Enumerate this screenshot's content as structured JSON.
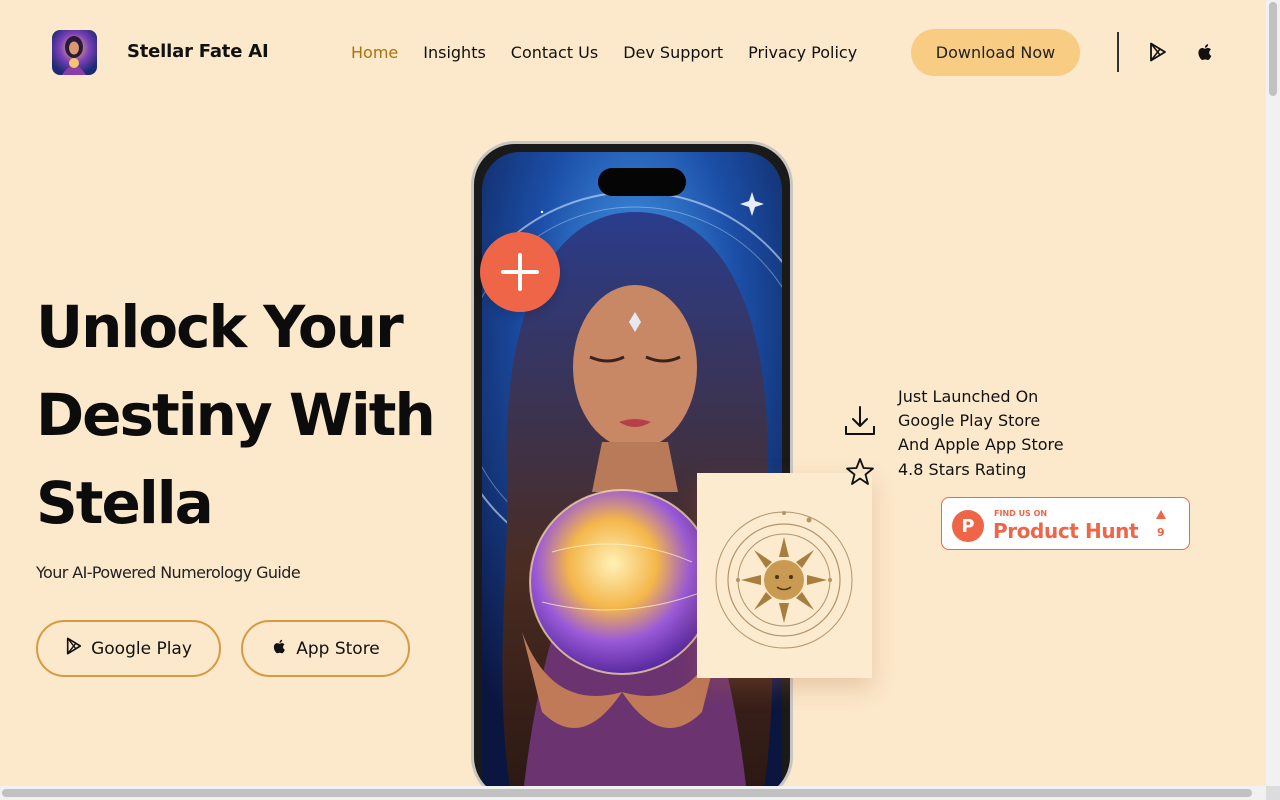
{
  "header": {
    "brand": "Stellar Fate AI",
    "nav": [
      {
        "label": "Home",
        "active": true
      },
      {
        "label": "Insights",
        "active": false
      },
      {
        "label": "Contact Us",
        "active": false
      },
      {
        "label": "Dev Support",
        "active": false
      },
      {
        "label": "Privacy Policy",
        "active": false
      }
    ],
    "download_label": "Download Now",
    "icons": [
      "google-play-icon",
      "apple-icon"
    ]
  },
  "hero": {
    "title_lines": [
      "Unlock Your",
      "Destiny With",
      "Stella"
    ],
    "subtitle": "Your AI-Powered Numerology Guide",
    "google_play_label": "Google Play",
    "app_store_label": "App Store"
  },
  "launch": {
    "lines": [
      "Just Launched On",
      "Google Play Store",
      "And Apple App Store"
    ],
    "rating": "4.8 Stars Rating"
  },
  "product_hunt": {
    "small": "FIND US ON",
    "big": "Product Hunt",
    "logo_letter": "P",
    "count": "9"
  },
  "colors": {
    "background": "#fce8cb",
    "accent": "#f9cc83",
    "active_nav": "#a9720a",
    "button_border": "#d79a42",
    "plus_button": "#ef6548",
    "product_hunt": "#ef6548"
  }
}
